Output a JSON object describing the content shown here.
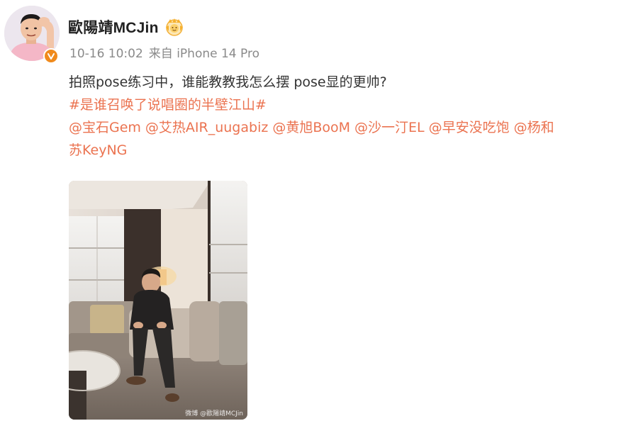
{
  "post": {
    "username": "歐陽靖MCJin",
    "time": "10-16 10:02",
    "source": "来自 iPhone 14 Pro",
    "text": "拍照pose练习中，谁能教教我怎么摆 pose显的更帅?",
    "hashtag": "#是谁召唤了说唱圈的半壁江山#",
    "mentions_line1": [
      "@宝石Gem",
      "@艾热AIR_uugabiz",
      "@黄旭BooM",
      "@沙一汀EL",
      "@早安没吃饱",
      "@杨和"
    ],
    "mentions_line2": [
      "苏KeyNG"
    ],
    "photo_watermark": "微博 @歐陽靖MCJin"
  },
  "icons": {
    "avatar": "avatar-photo",
    "verified": "verified-v-icon",
    "crown": "fan-crown-icon",
    "photo": "post-photo"
  },
  "colors": {
    "link": "#eb7350",
    "meta": "#8a8a8a",
    "text": "#333333",
    "verified": "#f08a1c"
  }
}
